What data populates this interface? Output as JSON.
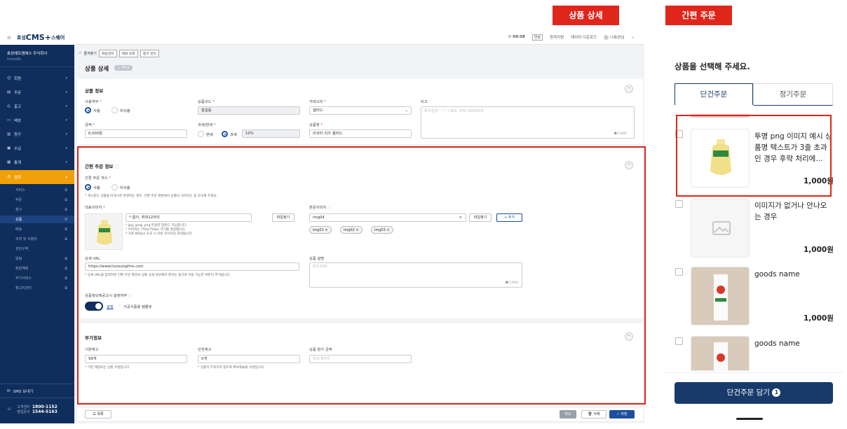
{
  "tags": {
    "detail": "상품 상세",
    "quick": "간편 주문"
  },
  "logo": {
    "prefix": "효성",
    "brand": "CMS+",
    "suffix": "스퀘어"
  },
  "company": {
    "name": "효성에프엠에스 주식회사",
    "sub": "hmsofie"
  },
  "topbar": {
    "time": "09:58",
    "extend": "연장",
    "remote": "원격지원",
    "download": "데이터 다운로드",
    "user": "나효성님"
  },
  "nav": [
    {
      "icon": "person-icon",
      "label": "회원"
    },
    {
      "icon": "document-icon",
      "label": "주문"
    },
    {
      "icon": "won-icon",
      "label": "출고"
    },
    {
      "icon": "truck-icon",
      "label": "배송"
    },
    {
      "icon": "invoice-icon",
      "label": "청구"
    },
    {
      "icon": "wallet-icon",
      "label": "수납"
    },
    {
      "icon": "stats-icon",
      "label": "통계"
    },
    {
      "icon": "gear-icon",
      "label": "설정"
    }
  ],
  "subnav": [
    "서비스",
    "주문",
    "청구",
    "상품",
    "배송",
    "조직 및 사용자",
    "권한구역",
    "알림",
    "회원혜택",
    "부가서비스",
    "출고지관리"
  ],
  "sidebar_bottom": {
    "sms": "SMS 보내기",
    "cs_label": "고객센터",
    "cs_num": "1800-1152",
    "sales_label": "영업문의",
    "sales_num": "1544-5163"
  },
  "bookmarks": {
    "label": "즐겨찾기",
    "items": [
      "회원관리",
      "계좌 조회",
      "청구 관리"
    ]
  },
  "page": {
    "title": "상품 상세",
    "badge": "매뉴얼"
  },
  "product_info": {
    "title": "상품 정보",
    "use_label": "사용여부",
    "use_yes": "사용",
    "use_no": "미사용",
    "code_label": "상품코드",
    "code": "홍길동",
    "cat_label": "카테고리",
    "cat": "샐러드",
    "memo_label": "비고",
    "memo_ph": "특수문자 \" \" ( ) 제외, 최대 2000자리",
    "memo_count": "0",
    "memo_max": "/1,000",
    "price_label": "금액",
    "price": "6,000원",
    "tax_label": "과세/면세",
    "tax_free": "면세",
    "tax": "과세",
    "tax_rate": "10%",
    "name_label": "상품명",
    "name": "리코타 치즈 샐러드"
  },
  "quick_info": {
    "title": "간편 주문 정보",
    "show_label": "간편 주문 게시",
    "show_yes": "사용",
    "show_no": "미사용",
    "show_note": "* 게시중인 상품을 미게시로 변경하는 경우, 간편 주문 화면에서 상품이 사라지는 점 유의해 주세요.",
    "rep_label": "대표이미지",
    "rep_file": "*-얼이, 최대12자리",
    "find": "파일찾기",
    "rep_notes": [
      "* jpg, jpeg, png 파일만 업로드 가능합니다.",
      "* 이미지는 750x750px 크기를 권장합니다.",
      "* 가로 860px 초과 시 자동 리사이징 처리됩니다."
    ],
    "body_label": "본문이미지",
    "body_file": "img04",
    "add": "+ 추가",
    "chips": [
      "img01",
      "img02",
      "img03"
    ],
    "url_label": "상세 URL",
    "url": "https://www.hyosungfms.com",
    "url_note": "* 상세 URL을 입력하면 간편 주문 화면의 상품 상세 정보에서 회하는 링크로 이동 가능한 버튼이 추가됩니다.",
    "desc_label": "상품 설명",
    "desc_ph": "0/2,000",
    "desc_count": "0",
    "desc_max": "/1,000",
    "notice_label": "상품정보제공고시 설정여부",
    "notice_toggle": "설정",
    "notice_type": "가공식품용 템플릿"
  },
  "extra_info": {
    "title": "부가정보",
    "stock_label": "기본재고",
    "stock": "99개",
    "stock_note": "* 기본 재입되는 상품 수량입니다.",
    "safe_label": "안전재고",
    "safe": "0개",
    "safe_note": "* 상품이 부족하지 않도록 확보해놓을 수량입니다.",
    "cost_label": "상품 원가 금액",
    "cost_ph": "최대 8자리"
  },
  "bottom": {
    "list": "목록",
    "cancel": "취소",
    "delete": "삭제",
    "save": "저장"
  },
  "right": {
    "heading": "상품을 선택해 주세요.",
    "tab_single": "단건주문",
    "tab_regular": "정기주문",
    "products": [
      {
        "name": "투명 png 이미지 예시 상품명 텍스트가 3줄 초과인 경우 후략 처리에...",
        "price": "1,000원",
        "img": "banana-milk"
      },
      {
        "name": "이미지가 없거나 안나오는 경우",
        "price": "1,000원",
        "img": "placeholder"
      },
      {
        "name": "goods name",
        "price": "1,000원",
        "img": "milk-carton"
      },
      {
        "name": "goods name",
        "price": "",
        "img": "milk-carton"
      }
    ],
    "cart_label": "단건주문 담기",
    "cart_count": "1"
  },
  "colors": {
    "navy": "#0f2e5c",
    "accent": "#f0a00a",
    "primary": "#1c4fa0",
    "red": "#e0251b",
    "cart": "#173a6b"
  }
}
